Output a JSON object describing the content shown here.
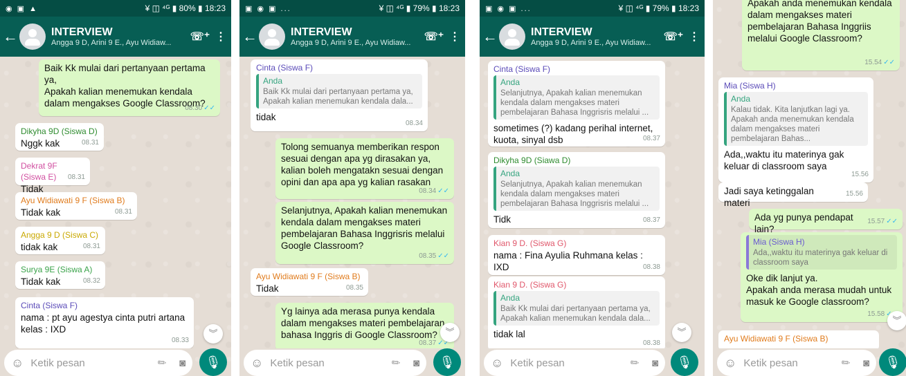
{
  "colors": {
    "header": "#075e54",
    "statusbar": "#054d44",
    "incoming": "#ffffff",
    "outgoing": "#dcf8c6",
    "mic": "#00897b",
    "ticks": "#34b7f1"
  },
  "icons": {
    "back": "arrow-left-icon",
    "add_call": "add-call-icon",
    "menu": "more-vert-icon",
    "emoji": "emoji-icon",
    "attach": "paperclip-icon",
    "camera": "camera-icon",
    "mic": "mic-icon",
    "scroll": "double-chevron-down-icon"
  },
  "header": {
    "title": "INTERVIEW",
    "subtitle": "Angga 9 D, Arini 9 E., Ayu Widiaw..."
  },
  "input": {
    "placeholder": "Ketik pesan"
  },
  "screens": [
    {
      "status_left": "◉ ▣ ▲",
      "status_right": "¥ ◫ ⁴ᴳ ▮ 80% ▮ 18:23",
      "messages": [
        {
          "sender": "",
          "text": "Baik Kk mulai dari pertanyaan pertama ya,\nApakah kalian menemukan kendala dalam mengakses Google Classroom?",
          "time": "08.30",
          "ticks": "✓✓"
        },
        {
          "sender": "Dikyha 9D (Siswa D)",
          "text": "Nggk kak",
          "time": "08.31"
        },
        {
          "sender": "Dekrat 9F (Siswa E)",
          "text": "Tidak",
          "time": "08.31"
        },
        {
          "sender": "Ayu Widiawati 9 F (Siswa B)",
          "text": "Tidak kak",
          "time": "08.31"
        },
        {
          "sender": "Angga 9 D (Siswa C)",
          "text": "tidak kak",
          "time": "08.31"
        },
        {
          "sender": "Surya 9E (Siswa A)",
          "text": "Tidak kak",
          "time": "08.32"
        },
        {
          "sender": "Cinta (Siswa F)",
          "text": "nama : pt ayu agestya cinta putri artana\nkelas : IXD",
          "time": "08.33"
        }
      ]
    },
    {
      "status_left": "▣ ◉ ▣ ...",
      "status_right": "¥ ◫ ⁴ᴳ ▮ 79% ▮ 18:23",
      "messages": [
        {
          "sender": "Cinta (Siswa F)",
          "quote_name": "Anda",
          "quote_text": "Baik Kk mulai dari pertanyaan pertama ya,\nApakah kalian menemukan kendala dala...",
          "text": "tidak",
          "time": "08.34"
        },
        {
          "sender": "",
          "text": "Tolong semuanya memberikan respon sesuai dengan apa yg dirasakan ya, kalian boleh mengatakn sesuai dengan opini dan apa apa yg kalian rasakan",
          "time": "08.34",
          "ticks": "✓✓"
        },
        {
          "sender": "",
          "text": "Selanjutnya, Apakah kalian menemukan kendala dalam mengakses materi pembelajaran Bahasa Inggrisris melalui Google Classroom?",
          "time": "08.35",
          "ticks": "✓✓"
        },
        {
          "sender": "Ayu Widiawati 9 F (Siswa B)",
          "text": "Tidak",
          "time": "08.35"
        },
        {
          "sender": "",
          "text": "Yg lainya ada merasa punya kendala dalam mengakses materi pembelajaran bahasa Inggris di Google Classroom?",
          "time": "08.37",
          "ticks": "✓✓"
        }
      ]
    },
    {
      "status_left": "▣ ◉ ▣ ...",
      "status_right": "¥ ◫ ⁴ᴳ ▮ 79% ▮ 18:23",
      "messages": [
        {
          "sender": "Cinta (Siswa F)",
          "quote_name": "Anda",
          "quote_text": "Selanjutnya, Apakah kalian menemukan kendala dalam mengakses materi pembelajaran Bahasa Inggrisris melalui ...",
          "text": "sometimes (?) kadang perihal internet, kuota, sinyal dsb",
          "time": "08.37"
        },
        {
          "sender": "Dikyha 9D (Siawa D)",
          "quote_name": "Anda",
          "quote_text": "Selanjutnya, Apakah kalian menemukan kendala dalam mengakses materi pembelajaran Bahasa Inggrisris melalui ...",
          "text": "Tidk",
          "time": "08.37"
        },
        {
          "sender": "Kian 9 D. (Siswa G)",
          "text": "nama : Fina Ayulia Ruhmana kelas : IXD",
          "time": "08.38"
        },
        {
          "sender": "Kian 9 D. (Siswa G)",
          "quote_name": "Anda",
          "quote_text": "Baik Kk mulai dari pertanyaan pertama ya,\nApakah kalian menemukan kendala dala...",
          "text": "tidak lal",
          "time": "08.38"
        }
      ]
    },
    {
      "status_left": "",
      "status_right": "",
      "messages": [
        {
          "sender": "",
          "text": "Apakah anda menemukan kendala dalam mengakses materi pembelajaran Bahasa Inggriis melalui Google Classroom?",
          "time": "15.54",
          "ticks": "✓✓"
        },
        {
          "sender": "Mia (Siswa H)",
          "quote_name": "Anda",
          "quote_text": "Kalau tidak. Kita lanjutkan lagi ya.\nApakah anda menemukan kendala dalam mengakses materi pembelajaran Bahas...",
          "text": "Ada,,waktu itu materinya gak keluar di classroom saya",
          "time": "15.56"
        },
        {
          "sender": "",
          "text": "Jadi saya ketinggalan materi",
          "time": "15.56"
        },
        {
          "sender": "",
          "text": "Ada yg punya pendapat lain?",
          "time": "15.57",
          "ticks": "✓✓"
        },
        {
          "sender": "",
          "quote_name": "Mia (Siswa H)",
          "quote_text": "Ada,,waktu itu materinya gak keluar di classroom saya",
          "text": "Oke dik lanjut ya.\nApakah anda merasa mudah untuk masuk ke Google classroom?",
          "time": "15.58",
          "ticks": "✓✓"
        },
        {
          "sender": "Ayu Widiawati 9 F (Siswa B)",
          "text": "",
          "time": ""
        }
      ]
    }
  ]
}
